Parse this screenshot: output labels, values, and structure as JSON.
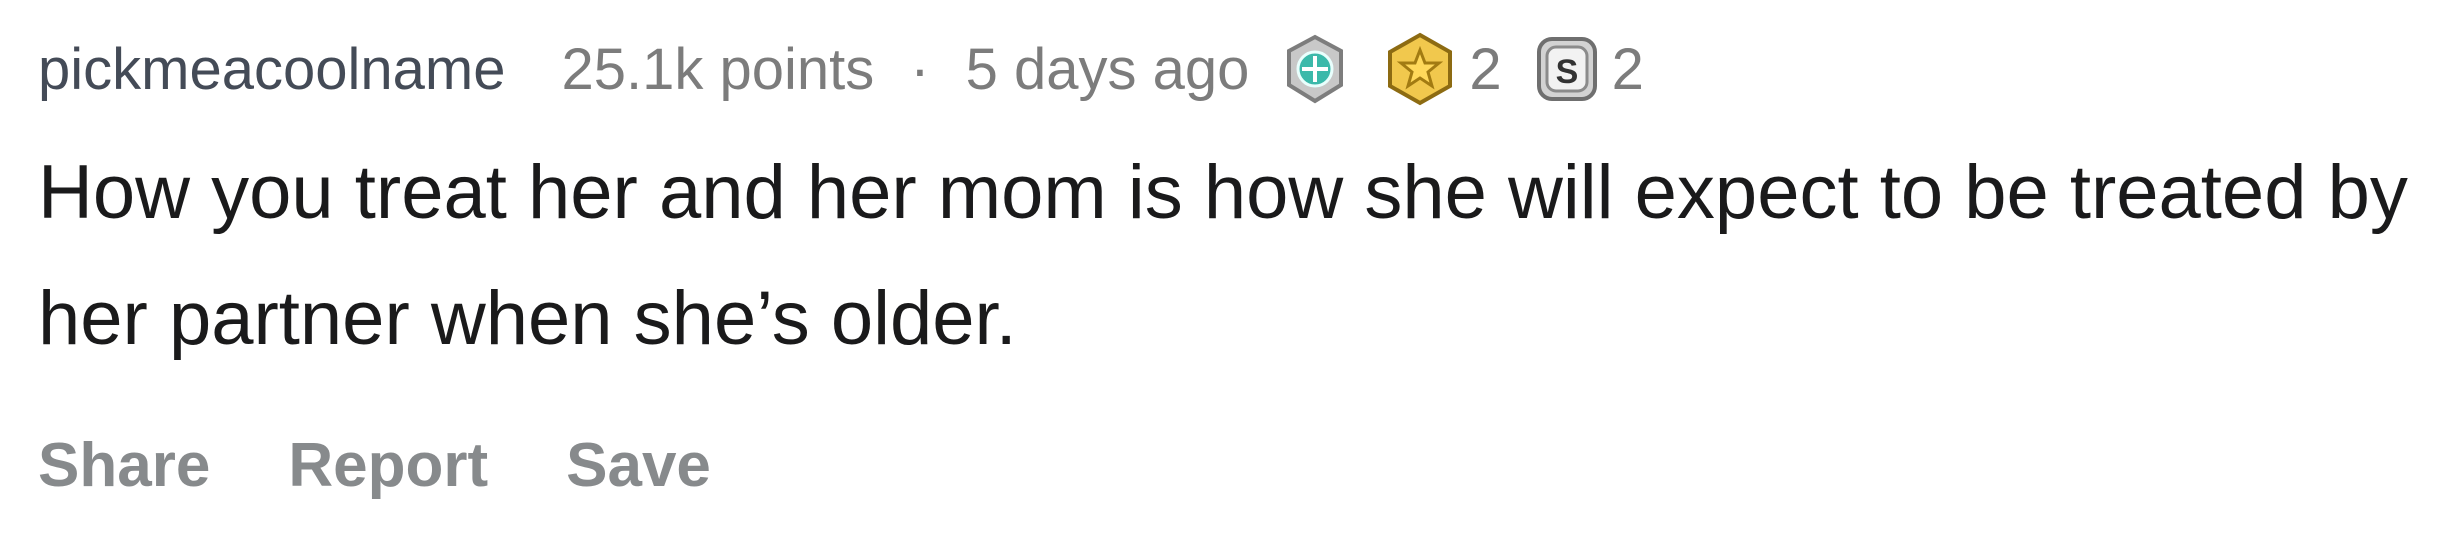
{
  "comment": {
    "author": "pickmeacoolname",
    "points": "25.1k points",
    "separator": "·",
    "age": "5 days ago",
    "awards": [
      {
        "icon": "silver-medal-icon",
        "count": ""
      },
      {
        "icon": "gold-star-icon",
        "count": "2"
      },
      {
        "icon": "s-coin-icon",
        "count": "2"
      }
    ],
    "body": "How you treat her and her mom is how she will expect to be treated by her partner when she’s older.",
    "actions": {
      "share": "Share",
      "report": "Report",
      "save": "Save"
    }
  },
  "colors": {
    "author": "#444b57",
    "meta": "#7c7c7c",
    "body": "#1a1a1b",
    "actions": "#878a8c",
    "gold_award": "#f2c94c",
    "teal_award": "#38b7a8"
  }
}
